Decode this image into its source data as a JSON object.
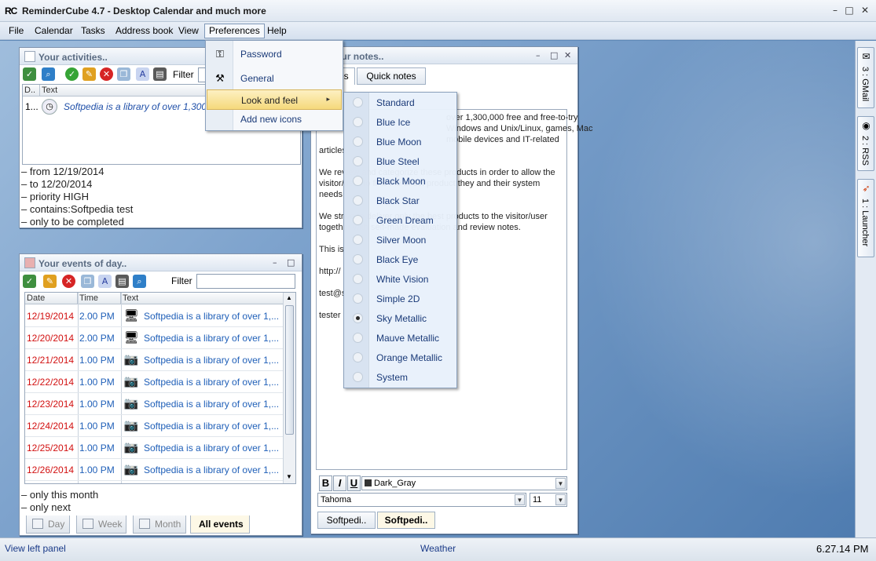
{
  "window": {
    "logo": "RC",
    "title": "ReminderCube 4.7 - Desktop Calendar and much more",
    "min": "–",
    "max": "□",
    "close": "✕"
  },
  "menubar": [
    "File",
    "Calendar",
    "Tasks",
    "Address book",
    "View",
    "Preferences",
    "Help"
  ],
  "preferences_menu": {
    "items": [
      {
        "label": "Password",
        "icon": "key-icon"
      },
      {
        "label": "General",
        "icon": "tools-icon"
      },
      {
        "label": "Look and feel",
        "icon": "",
        "submenu_arrow": "▸"
      },
      {
        "label": "Add new icons",
        "icon": ""
      }
    ]
  },
  "look_and_feel_menu": {
    "items": [
      "Standard",
      "Blue Ice",
      "Blue Moon",
      "Blue Steel",
      "Black Moon",
      "Black Star",
      "Green Dream",
      "Silver Moon",
      "Black Eye",
      "White Vision",
      "Simple 2D",
      "Sky Metallic",
      "Mauve Metallic",
      "Orange Metallic",
      "System"
    ],
    "selected": "Sky Metallic"
  },
  "activities": {
    "title": "Your activities..",
    "filter_label": "Filter",
    "columns": [
      "D..",
      "Text"
    ],
    "row": {
      "d": "1...",
      "text": "Softpedia is a library of over 1,300"
    },
    "criteria": [
      "– from 12/19/2014",
      "– to 12/20/2014",
      "– priority HIGH",
      "– contains:Softpedia test",
      "– only to be completed"
    ]
  },
  "events": {
    "title": "Your events of day..",
    "filter_label": "Filter",
    "columns": [
      "Date",
      "Time",
      "Text"
    ],
    "rows": [
      {
        "date": "12/19/2014",
        "time": "2.00 PM",
        "icon": "computer-icon",
        "text": "Softpedia is a library of over 1,..."
      },
      {
        "date": "12/20/2014",
        "time": "2.00 PM",
        "icon": "computer-icon",
        "text": "Softpedia is a library of over 1,..."
      },
      {
        "date": "12/21/2014",
        "time": "1.00 PM",
        "icon": "camera-icon",
        "text": "Softpedia is a library of over 1,..."
      },
      {
        "date": "12/22/2014",
        "time": "1.00 PM",
        "icon": "camera-icon",
        "text": "Softpedia is a library of over 1,..."
      },
      {
        "date": "12/23/2014",
        "time": "1.00 PM",
        "icon": "camera-icon",
        "text": "Softpedia is a library of over 1,..."
      },
      {
        "date": "12/24/2014",
        "time": "1.00 PM",
        "icon": "camera-icon",
        "text": "Softpedia is a library of over 1,..."
      },
      {
        "date": "12/25/2014",
        "time": "1.00 PM",
        "icon": "camera-icon",
        "text": "Softpedia is a library of over 1,..."
      },
      {
        "date": "12/26/2014",
        "time": "1.00 PM",
        "icon": "camera-icon",
        "text": "Softpedia is a library of over 1,..."
      }
    ],
    "criteria": [
      "– only this month",
      "– only next"
    ],
    "view_tabs": [
      "Day",
      "Week",
      "Month",
      "All events"
    ],
    "selected_view": "All events"
  },
  "notes": {
    "title": "Your notes..",
    "tabs": [
      "Notes",
      "Quick notes"
    ],
    "text_lines": [
      "over 1,300,000 free and free-to-try",
      "Windows and Unix/Linux, games, Mac",
      "mobile devices and IT-related",
      "articles",
      "We review and categorize these products in order to allow the",
      "visitor/user to find the exact product they and their system",
      "needs.",
      "We strive to deliver only the best products to the visitor/user",
      "together with self-made evaluation and review notes.",
      "This is",
      "http://",
      "test@s",
      "tester"
    ],
    "bold": "B",
    "italic": "I",
    "underline": "U",
    "color_value": "Dark_Gray",
    "font_value": "Tahoma",
    "size_value": "11",
    "bottom_tabs": [
      "Softpedi..",
      "Softpedi.."
    ]
  },
  "side_tabs": [
    "3 : GMail",
    "2 : RSS",
    "1 : Launcher"
  ],
  "status": {
    "left": "View left panel",
    "center": "Weather",
    "right": "6.27.14 PM"
  }
}
